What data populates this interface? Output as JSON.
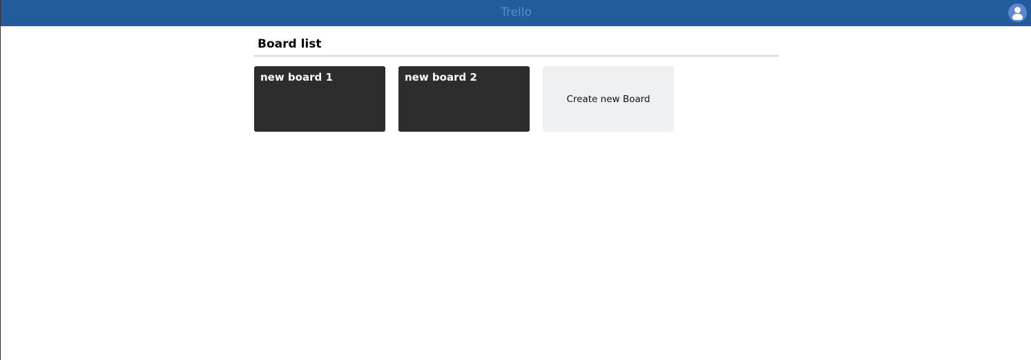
{
  "header": {
    "title": "Trello",
    "avatar_icon": "user-icon"
  },
  "main": {
    "title": "Board list",
    "boards": [
      {
        "label": "new board 1"
      },
      {
        "label": "new board 2"
      }
    ],
    "create_label": "Create new Board"
  },
  "colors": {
    "header": "#235c9c",
    "board": "#2d2d2d",
    "create": "#eff0f2"
  }
}
